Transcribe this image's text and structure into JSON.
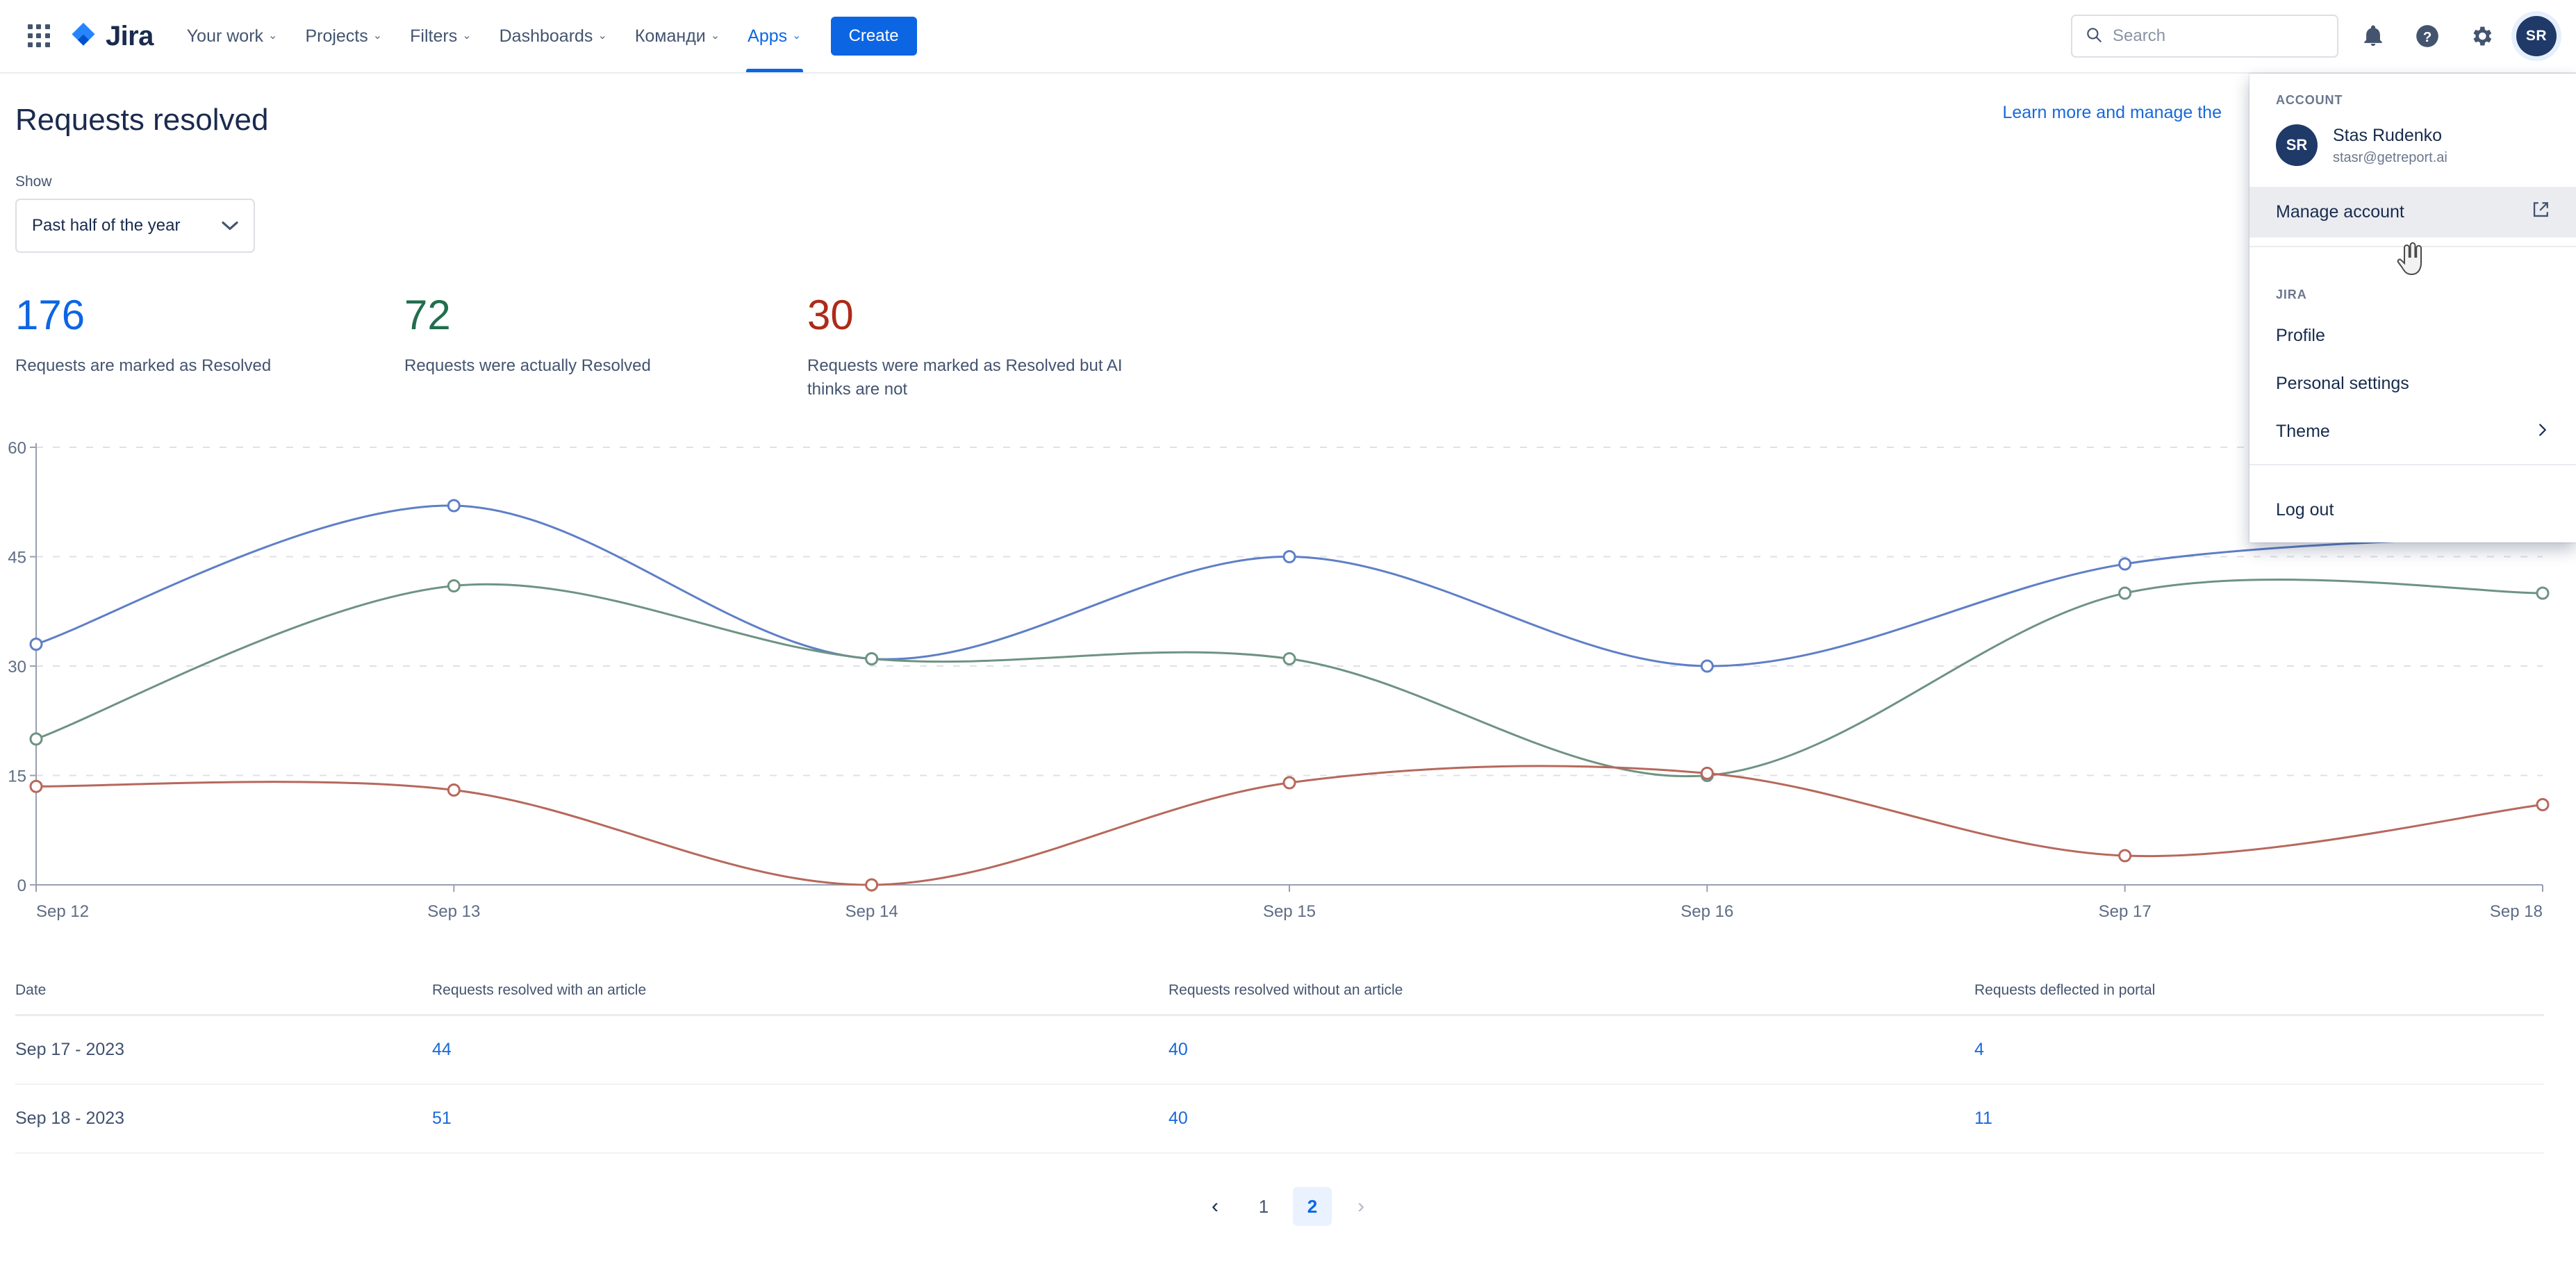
{
  "nav": {
    "app_switcher": "app-switcher-icon",
    "logo_text": "Jira",
    "items": [
      {
        "label": "Your work",
        "has_caret": true,
        "active": false
      },
      {
        "label": "Projects",
        "has_caret": true,
        "active": false
      },
      {
        "label": "Filters",
        "has_caret": true,
        "active": false
      },
      {
        "label": "Dashboards",
        "has_caret": true,
        "active": false
      },
      {
        "label": "Команди",
        "has_caret": true,
        "active": false
      },
      {
        "label": "Apps",
        "has_caret": true,
        "active": true
      }
    ],
    "create_label": "Create",
    "search_placeholder": "Search",
    "search_value": "",
    "avatar_initials": "SR",
    "icons": [
      "notifications-icon",
      "help-icon",
      "settings-icon",
      "avatar"
    ]
  },
  "header": {
    "title": "Requests resolved",
    "learn_more_link": "Learn more and manage the"
  },
  "filter": {
    "label": "Show",
    "selected": "Past half of the year",
    "options": [
      "Past half of the year"
    ]
  },
  "metrics": [
    {
      "value": "176",
      "description": "Requests are marked as Resolved",
      "color": "#0C66E4"
    },
    {
      "value": "72",
      "description": "Requests were actually Resolved",
      "color": "#216E4E"
    },
    {
      "value": "30",
      "description": "Requests were marked as Resolved but AI thinks are not",
      "color": "#AE2A19"
    }
  ],
  "chart_data": {
    "type": "line",
    "title": "Requests resolved",
    "xlabel": "",
    "ylabel": "",
    "ylim": [
      0,
      60
    ],
    "yticks": [
      0,
      15,
      30,
      45,
      60
    ],
    "grid": true,
    "legend": "none",
    "categories": [
      "Sep 12",
      "Sep 13",
      "Sep 14",
      "Sep 15",
      "Sep 16",
      "Sep 17",
      "Sep 18"
    ],
    "series": [
      {
        "name": "Requests resolved with an article",
        "color": "#5E7FC7",
        "values": [
          33,
          52,
          31,
          45,
          30,
          44,
          48
        ]
      },
      {
        "name": "Requests resolved without an article",
        "color": "#6E9383",
        "values": [
          20,
          41,
          31,
          31,
          15,
          40,
          40
        ]
      },
      {
        "name": "Requests deflected in portal",
        "color": "#B7685C",
        "values": [
          13.5,
          13,
          0,
          14,
          15.3,
          4,
          11
        ]
      }
    ]
  },
  "table": {
    "columns": [
      "Date",
      "Requests resolved with an article",
      "Requests resolved without an article",
      "Requests deflected in portal"
    ],
    "rows": [
      {
        "date": "Sep 17 - 2023",
        "with_article": "44",
        "without_article": "40",
        "deflected": "4"
      },
      {
        "date": "Sep 18 - 2023",
        "with_article": "51",
        "without_article": "40",
        "deflected": "11"
      }
    ]
  },
  "pagination": {
    "prev": "‹",
    "next": "›",
    "pages": [
      "1",
      "2"
    ],
    "current": "2"
  },
  "account_menu": {
    "section_account": "ACCOUNT",
    "user_name": "Stas Rudenko",
    "user_email": "stasr@getreport.ai",
    "user_initials": "SR",
    "manage_account": "Manage account",
    "section_jira": "JIRA",
    "profile": "Profile",
    "personal_settings": "Personal settings",
    "theme": "Theme",
    "log_out": "Log out"
  }
}
